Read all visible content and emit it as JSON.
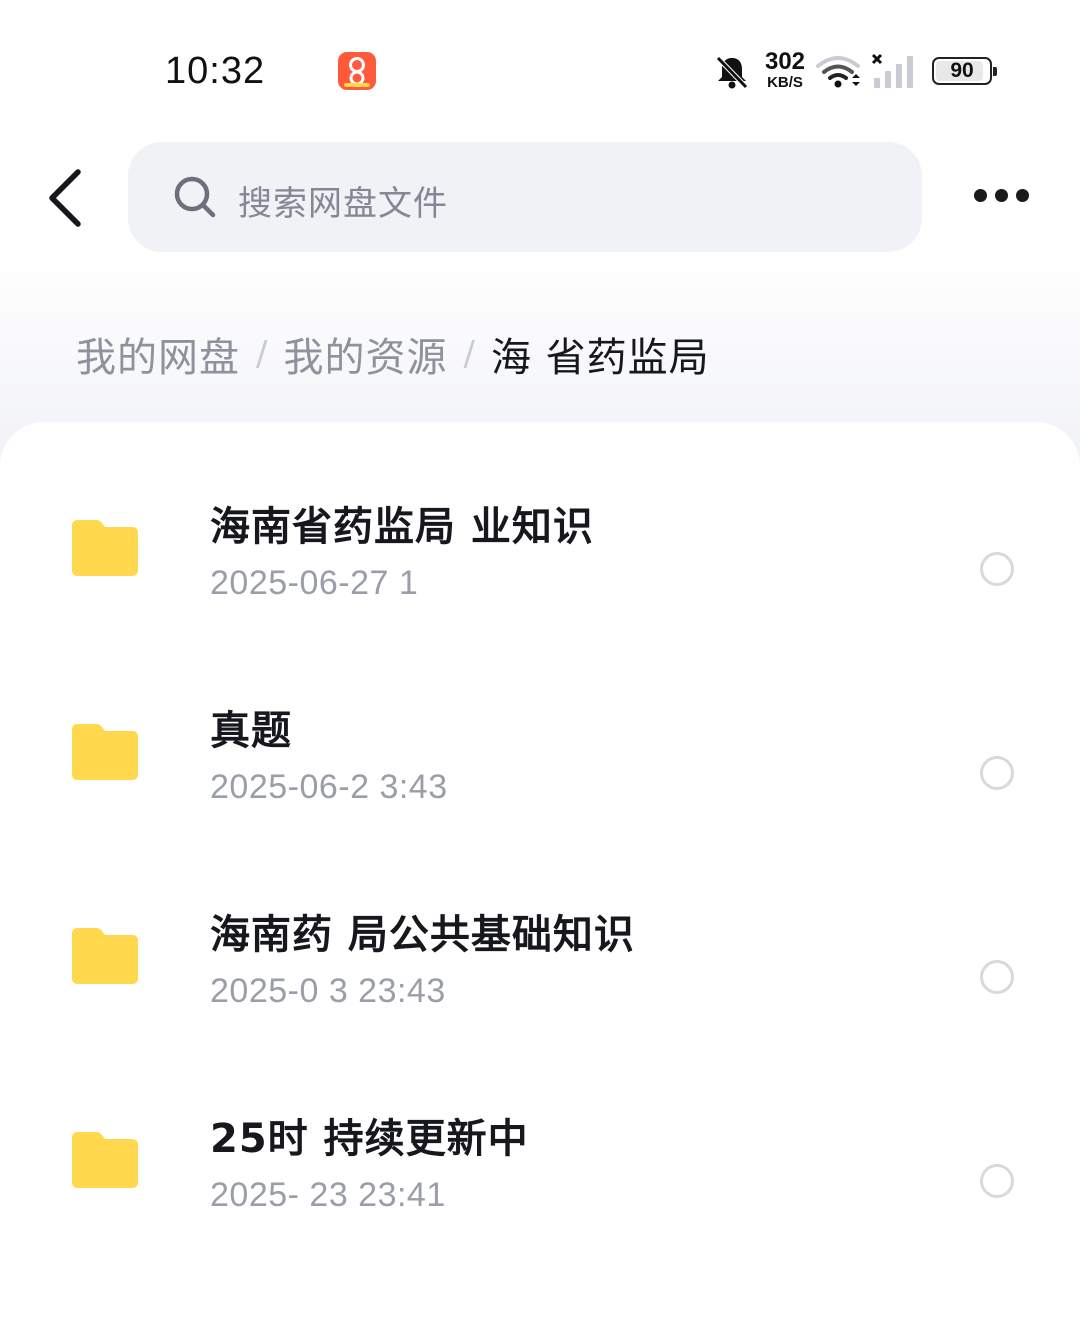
{
  "status_bar": {
    "time": "10:32",
    "net_speed_value": "302",
    "net_speed_unit": "KB/S",
    "battery_level": "90",
    "battery_fraction": 0.9
  },
  "header": {
    "search_placeholder": "搜索网盘文件"
  },
  "breadcrumb": {
    "items": [
      "我的网盘",
      "我的资源",
      "海 省药监局"
    ],
    "separator": "/"
  },
  "files": [
    {
      "name": "海南省药监局 业知识",
      "date": "2025-06-27  1",
      "type": "folder"
    },
    {
      "name": "真题",
      "date": "2025-06-2 3:43",
      "type": "folder"
    },
    {
      "name": "海南药 局公共基础知识",
      "date": "2025-0 3  23:43",
      "type": "folder"
    },
    {
      "name": "25时 持续更新中",
      "date": "2025- 23  23:41",
      "type": "folder"
    }
  ],
  "colors": {
    "folder": "#ffd84d",
    "search_bg": "#f1f2f6",
    "text_primary": "#16181d",
    "text_secondary": "#9a9ea8",
    "app_badge": "#ff5a3c"
  }
}
